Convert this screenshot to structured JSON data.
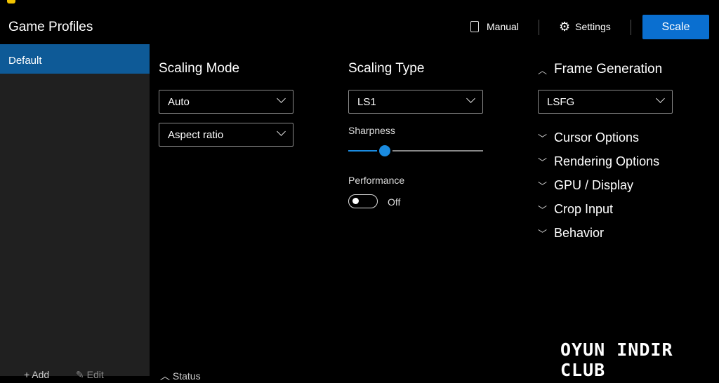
{
  "sidebar": {
    "title": "Game Profiles",
    "items": [
      {
        "label": "Default"
      }
    ],
    "add_label": "Add",
    "edit_label": "Edit"
  },
  "toolbar": {
    "manual_label": "Manual",
    "settings_label": "Settings",
    "scale_label": "Scale"
  },
  "scaling_mode": {
    "title": "Scaling Mode",
    "mode": "Auto",
    "aspect": "Aspect ratio"
  },
  "scaling_type": {
    "title": "Scaling Type",
    "type": "LS1",
    "sharpness_label": "Sharpness",
    "sharpness_value": 0.27,
    "performance_label": "Performance",
    "performance_state": "Off"
  },
  "frame_generation": {
    "title": "Frame Generation",
    "value": "LSFG"
  },
  "sections": [
    "Cursor Options",
    "Rendering Options",
    "GPU / Display",
    "Crop Input",
    "Behavior"
  ],
  "status": {
    "label": "Status"
  },
  "watermark": "OYUN INDIR CLUB",
  "colors": {
    "accent": "#0a6fd0",
    "selected": "#0e5a97"
  }
}
